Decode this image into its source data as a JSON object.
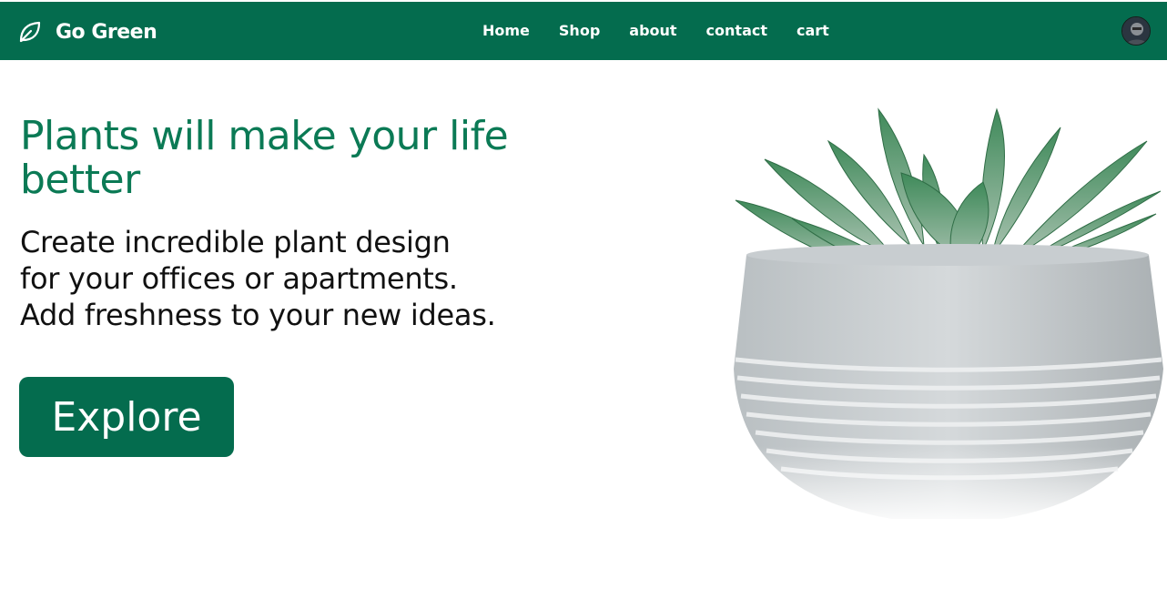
{
  "navbar": {
    "brand_icon": "leaf-icon",
    "brand_name": "Go Green",
    "links": [
      {
        "label": "Home"
      },
      {
        "label": "Shop"
      },
      {
        "label": "about"
      },
      {
        "label": "contact"
      },
      {
        "label": "cart"
      }
    ],
    "avatar": "user-avatar"
  },
  "hero": {
    "title": "Plants will make your life better",
    "description_lines": [
      "Create incredible plant design",
      "for your offices or apartments.",
      "Add freshness to your new ideas."
    ],
    "cta_label": "Explore",
    "image": "succulent-in-concrete-pot"
  },
  "colors": {
    "brand_green": "#046c4e",
    "title_green": "#0b7a55",
    "text_dark": "#111111"
  }
}
